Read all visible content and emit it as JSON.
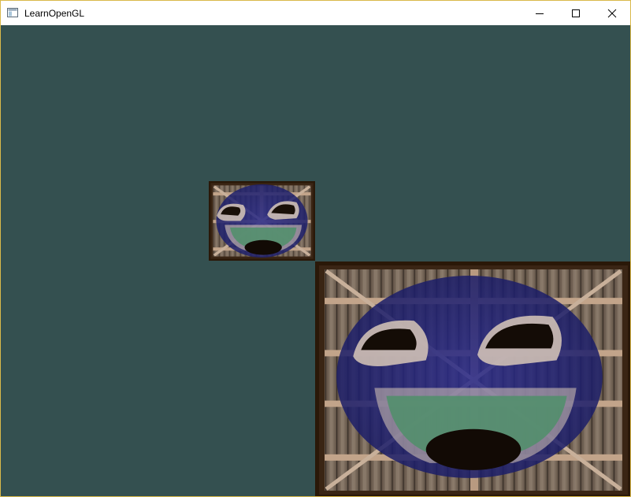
{
  "window": {
    "title": "LearnOpenGL",
    "controls": {
      "minimize": "minimize-icon",
      "maximize": "maximize-icon",
      "close": "close-icon"
    }
  },
  "scene": {
    "clear_color": "#345050",
    "objects": [
      {
        "name": "textured-quad-small",
        "texture": "container-with-awesomeface"
      },
      {
        "name": "textured-quad-large",
        "texture": "container-with-awesomeface"
      }
    ]
  }
}
